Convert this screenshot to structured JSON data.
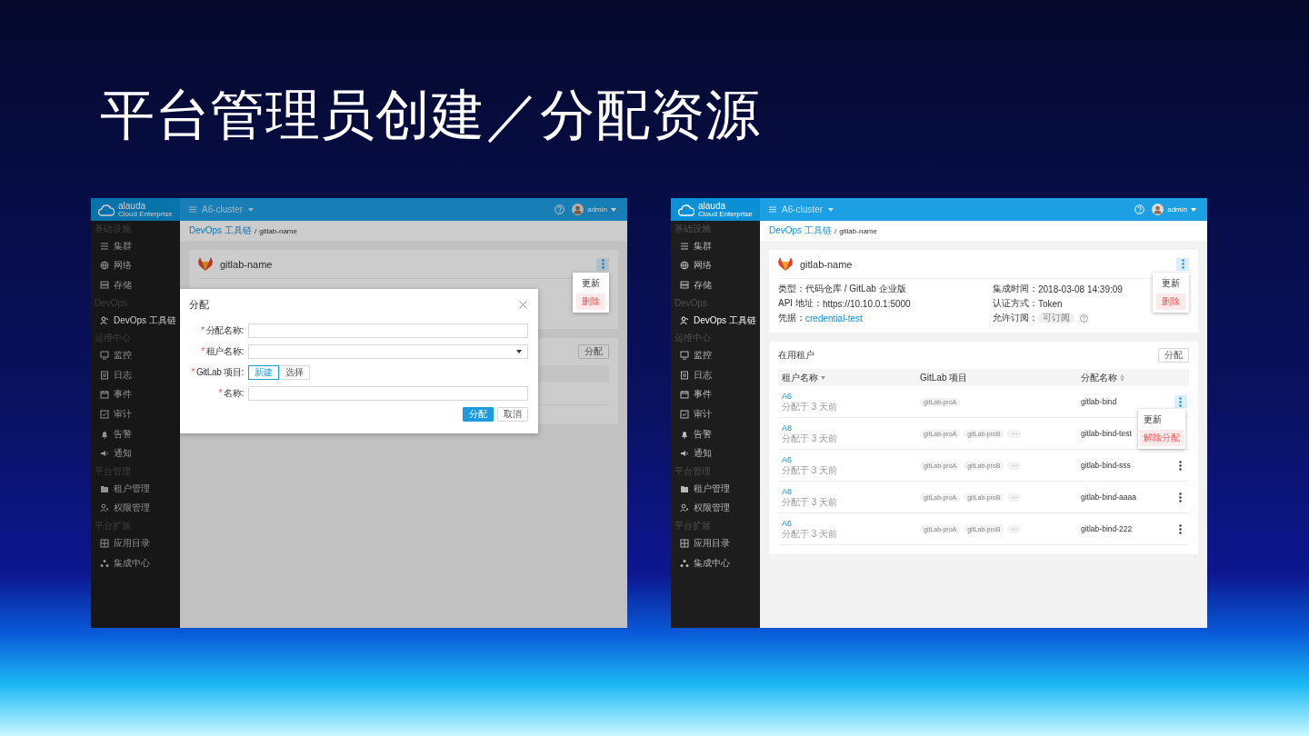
{
  "slide": {
    "title": "平台管理员创建／分配资源"
  },
  "screens": [
    {
      "logo": {
        "name": "alauda",
        "tagline": "Cloud Enterprise"
      },
      "cluster": "A6-cluster",
      "user": "admin",
      "sidebar": [
        {
          "heading": "基础设施",
          "items": [
            {
              "label": "集群",
              "selected": false
            },
            {
              "label": "网络",
              "selected": false
            },
            {
              "label": "存储",
              "selected": false
            }
          ]
        },
        {
          "heading": "DevOps",
          "items": [
            {
              "label": "DevOps 工具链",
              "selected": true
            }
          ]
        },
        {
          "heading": "运维中心",
          "items": [
            {
              "label": "监控",
              "selected": false
            },
            {
              "label": "日志",
              "selected": false
            },
            {
              "label": "事件",
              "selected": false
            },
            {
              "label": "审计",
              "selected": false
            },
            {
              "label": "告警",
              "selected": false
            },
            {
              "label": "通知",
              "selected": false
            }
          ]
        },
        {
          "heading": "平台管理",
          "items": [
            {
              "label": "租户管理",
              "selected": false
            },
            {
              "label": "权限管理",
              "selected": false
            }
          ]
        },
        {
          "heading": "平台扩展",
          "items": [
            {
              "label": "应用目录",
              "selected": false
            },
            {
              "label": "集成中心",
              "selected": false
            }
          ]
        }
      ],
      "breadcrumb": {
        "link": "DevOps 工具链",
        "separator": "/",
        "current": "gitlab-name"
      },
      "tool": {
        "name": "gitlab-name",
        "menu_open": true,
        "menu": [
          {
            "label": "更新",
            "kind": "normal"
          },
          {
            "label": "删除",
            "kind": "danger"
          }
        ]
      },
      "tenants": {
        "assign_button": "分配"
      },
      "dialog": {
        "title": "分配",
        "required_mark": "*",
        "fields": [
          {
            "label": "分配名称:",
            "required": true,
            "kind": "text"
          },
          {
            "label": "租户名称:",
            "required": true,
            "kind": "select"
          },
          {
            "label": "GitLab 项目:",
            "required": true,
            "kind": "toggle",
            "options": [
              {
                "label": "新建",
                "selected": true
              },
              {
                "label": "选择",
                "selected": false
              }
            ]
          },
          {
            "label": "名称:",
            "required": true,
            "kind": "text"
          }
        ],
        "buttons": [
          {
            "label": "分配",
            "kind": "primary"
          },
          {
            "label": "取消",
            "kind": "default"
          }
        ]
      }
    },
    {
      "logo": {
        "name": "alauda",
        "tagline": "Cloud Enterprise"
      },
      "cluster": "A6-cluster",
      "user": "admin",
      "sidebar": [
        {
          "heading": "基础设施",
          "items": [
            {
              "label": "集群",
              "selected": false
            },
            {
              "label": "网络",
              "selected": false
            },
            {
              "label": "存储",
              "selected": false
            }
          ]
        },
        {
          "heading": "DevOps",
          "items": [
            {
              "label": "DevOps 工具链",
              "selected": true
            }
          ]
        },
        {
          "heading": "运维中心",
          "items": [
            {
              "label": "监控",
              "selected": false
            },
            {
              "label": "日志",
              "selected": false
            },
            {
              "label": "事件",
              "selected": false
            },
            {
              "label": "审计",
              "selected": false
            },
            {
              "label": "告警",
              "selected": false
            },
            {
              "label": "通知",
              "selected": false
            }
          ]
        },
        {
          "heading": "平台管理",
          "items": [
            {
              "label": "租户管理",
              "selected": false
            },
            {
              "label": "权限管理",
              "selected": false
            }
          ]
        },
        {
          "heading": "平台扩展",
          "items": [
            {
              "label": "应用目录",
              "selected": false
            },
            {
              "label": "集成中心",
              "selected": false
            }
          ]
        }
      ],
      "breadcrumb": {
        "link": "DevOps 工具链",
        "separator": "/",
        "current": "gitlab-name"
      },
      "tool": {
        "name": "gitlab-name",
        "menu_open": true,
        "menu": [
          {
            "label": "更新",
            "kind": "normal"
          },
          {
            "label": "删除",
            "kind": "danger"
          }
        ],
        "details": [
          {
            "label": "类型：",
            "value": "代码仓库 / GitLab 企业版",
            "kind": "text"
          },
          {
            "label": "集成时间：",
            "value": "2018-03-08 14:39:09",
            "kind": "text"
          },
          {
            "label": "API 地址：",
            "value": "https://10.10.0.1:5000",
            "kind": "text"
          },
          {
            "label": "认证方式：",
            "value": "Token",
            "kind": "text"
          },
          {
            "label": "凭据：",
            "value": "credential-test",
            "kind": "link"
          },
          {
            "label": "允许订阅：",
            "value": "可订阅",
            "kind": "tag"
          }
        ]
      },
      "tenants": {
        "title": "在用租户",
        "assign_button": "分配",
        "columns": [
          {
            "label": "租户名称",
            "sortable": true,
            "sorted": true
          },
          {
            "label": "GitLab 项目",
            "sortable": false,
            "sorted": false
          },
          {
            "label": "分配名称",
            "sortable": true,
            "sorted": false
          }
        ],
        "rows": [
          {
            "tenant": "A6",
            "assigned": "分配于 3 天前",
            "projects": [
              "gitLab-proA"
            ],
            "binding": "gitlab-bind",
            "menu_open": true,
            "menu": [
              {
                "label": "更新",
                "kind": "normal"
              },
              {
                "label": "解除分配",
                "kind": "danger"
              }
            ]
          },
          {
            "tenant": "A8",
            "assigned": "分配于 3 天前",
            "projects": [
              "gitLab-proA",
              "gitLab-proB"
            ],
            "more": "···",
            "binding": "gitlab-bind-test"
          },
          {
            "tenant": "A6",
            "assigned": "分配于 3 天前",
            "projects": [
              "gitLab-proA",
              "gitLab-proB"
            ],
            "more": "···",
            "binding": "gitlab-bind-sss",
            "menu_open": false
          },
          {
            "tenant": "A8",
            "assigned": "分配于 3 天前",
            "projects": [
              "gitLab-proA",
              "gitLab-proB"
            ],
            "more": "···",
            "binding": "gitlab-bind-aaaa",
            "menu_open": false
          },
          {
            "tenant": "A6",
            "assigned": "分配于 3 天前",
            "projects": [
              "gitLab-proA",
              "gitLab-proB"
            ],
            "more": "···",
            "binding": "gitlab-bind-222",
            "menu_open": false
          }
        ]
      }
    }
  ]
}
